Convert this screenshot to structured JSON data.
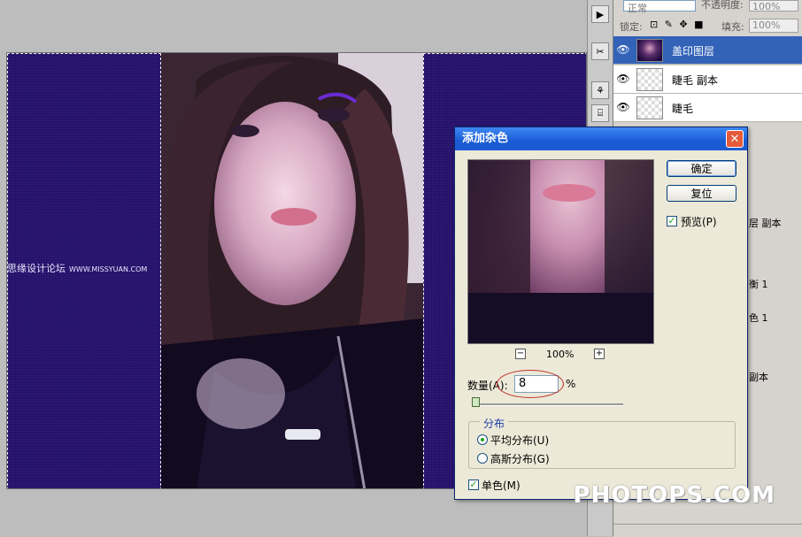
{
  "layers_panel": {
    "blend_mode": "正常",
    "opacity_label": "不透明度:",
    "opacity_value": "100%",
    "lock_label": "锁定:",
    "lock_icons": "⊡ ✎ ✥ ■",
    "fill_label": "填充:",
    "fill_value": "100%",
    "layers": [
      {
        "name": "盖印图层",
        "selected": true
      },
      {
        "name": "睫毛 副本",
        "selected": false
      },
      {
        "name": "睫毛",
        "selected": false
      }
    ],
    "partial_names": [
      "层 副本",
      "衡 1",
      "色 1",
      "副本"
    ]
  },
  "canvas": {
    "watermark": "思缘设计论坛",
    "watermark_url": "WWW.MISSYUAN.COM"
  },
  "dialog": {
    "title": "添加杂色",
    "close_glyph": "✕",
    "ok_label": "确定",
    "reset_label": "复位",
    "preview_label": "预览(P)",
    "zoom_out": "−",
    "zoom_in": "+",
    "zoom_percent": "100%",
    "amount_label": "数量(A):",
    "amount_value": "8",
    "amount_unit": "%",
    "distribution_title": "分布",
    "uniform_label": "平均分布(U)",
    "gaussian_label": "高斯分布(G)",
    "monochrome_label": "单色(M)",
    "preview_checked": true,
    "monochrome_checked": true,
    "selected_distribution": "uniform"
  },
  "brand": "PHOTOPS.COM",
  "colors": {
    "canvas_purple": "#25116a",
    "selection_blue": "#3363b8",
    "title_bar": "#1a5bd6",
    "annotation_red": "#c0302a"
  }
}
